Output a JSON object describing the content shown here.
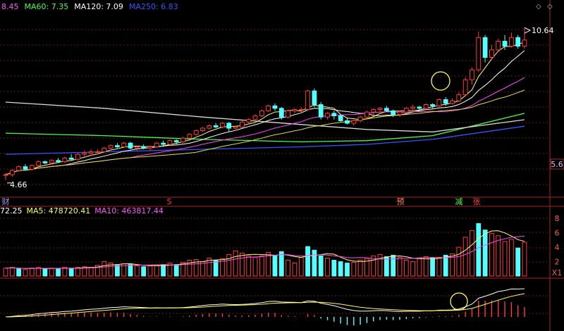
{
  "toolbar": {
    "left_arrow": "◇",
    "right_arrow": "◇"
  },
  "price_header": [
    {
      "text": "8.45",
      "color": "#ff55ff"
    },
    {
      "text": "MA60: 7.35",
      "color": "#44ff44"
    },
    {
      "text": "MA120: 7.09",
      "color": "#ffffff"
    },
    {
      "text": "MA250: 6.83",
      "color": "#3355ff"
    }
  ],
  "volume_header": [
    {
      "text": "72.25",
      "color": "#ffffff"
    },
    {
      "text": "MA5: 478720.41",
      "color": "#ffff44"
    },
    {
      "text": "MA10: 463817.44",
      "color": "#ff55ff"
    }
  ],
  "price_right_label": "5.6",
  "volume_ticks": [
    "8",
    "6",
    "4",
    "2"
  ],
  "volume_unit": "X1",
  "markers": [
    {
      "text": "财",
      "color": "#9999ff"
    },
    {
      "text": "S",
      "color": "#ff3333"
    },
    {
      "text": "预",
      "color": "#ff8844"
    },
    {
      "text": "减",
      "color": "#44ff44"
    },
    {
      "text": "张",
      "color": "#ff4444"
    }
  ],
  "chart_data": {
    "type": "candlestick",
    "price_scale": [
      4.2,
      11.4
    ],
    "high_label": "10.64",
    "low_label": "4.66",
    "candles": [
      [
        4.85,
        4.95,
        4.66,
        4.88
      ],
      [
        4.88,
        5.1,
        4.8,
        5.05
      ],
      [
        5.05,
        5.25,
        5.0,
        5.2
      ],
      [
        5.2,
        5.3,
        5.05,
        5.1
      ],
      [
        5.1,
        5.3,
        5.05,
        5.25
      ],
      [
        5.25,
        5.45,
        5.2,
        5.4
      ],
      [
        5.4,
        5.45,
        5.3,
        5.35
      ],
      [
        5.35,
        5.5,
        5.3,
        5.45
      ],
      [
        5.45,
        5.55,
        5.35,
        5.4
      ],
      [
        5.4,
        5.6,
        5.35,
        5.55
      ],
      [
        5.55,
        5.7,
        5.45,
        5.5
      ],
      [
        5.5,
        5.75,
        5.45,
        5.7
      ],
      [
        5.7,
        5.85,
        5.6,
        5.75
      ],
      [
        5.75,
        5.9,
        5.65,
        5.8
      ],
      [
        5.8,
        5.9,
        5.7,
        5.8
      ],
      [
        5.8,
        6.0,
        5.75,
        5.95
      ],
      [
        5.95,
        6.1,
        5.85,
        6.05
      ],
      [
        6.05,
        6.15,
        5.95,
        6.0
      ],
      [
        6.0,
        6.2,
        5.95,
        6.15
      ],
      [
        6.15,
        6.2,
        5.9,
        5.95
      ],
      [
        5.95,
        6.05,
        5.85,
        6.0
      ],
      [
        6.0,
        6.1,
        5.9,
        5.95
      ],
      [
        5.95,
        6.05,
        5.85,
        6.0
      ],
      [
        6.0,
        6.2,
        5.95,
        6.15
      ],
      [
        6.15,
        6.25,
        6.0,
        6.1
      ],
      [
        6.1,
        6.3,
        6.05,
        6.25
      ],
      [
        6.25,
        6.3,
        6.1,
        6.2
      ],
      [
        6.2,
        6.4,
        6.15,
        6.35
      ],
      [
        6.35,
        6.55,
        6.3,
        6.5
      ],
      [
        6.5,
        6.7,
        6.45,
        6.65
      ],
      [
        6.65,
        6.8,
        6.6,
        6.75
      ],
      [
        6.75,
        6.9,
        6.7,
        6.85
      ],
      [
        6.85,
        6.95,
        6.75,
        6.8
      ],
      [
        6.8,
        7.0,
        6.75,
        6.95
      ],
      [
        6.95,
        7.0,
        6.6,
        6.75
      ],
      [
        6.75,
        6.85,
        6.65,
        6.8
      ],
      [
        6.8,
        7.05,
        6.75,
        7.0
      ],
      [
        7.0,
        7.15,
        6.95,
        7.1
      ],
      [
        7.1,
        7.3,
        7.05,
        7.25
      ],
      [
        7.25,
        7.5,
        7.2,
        7.45
      ],
      [
        7.45,
        7.7,
        7.4,
        7.65
      ],
      [
        7.65,
        7.75,
        7.45,
        7.55
      ],
      [
        7.55,
        7.6,
        7.1,
        7.2
      ],
      [
        7.2,
        7.5,
        7.15,
        7.45
      ],
      [
        7.45,
        7.55,
        7.35,
        7.5
      ],
      [
        7.5,
        7.6,
        7.35,
        7.5
      ],
      [
        7.5,
        8.3,
        7.45,
        8.25
      ],
      [
        8.25,
        8.35,
        7.6,
        7.7
      ],
      [
        7.7,
        7.8,
        7.1,
        7.2
      ],
      [
        7.2,
        7.4,
        7.1,
        7.35
      ],
      [
        7.35,
        7.45,
        7.1,
        7.25
      ],
      [
        7.25,
        7.3,
        7.0,
        7.05
      ],
      [
        7.05,
        7.15,
        6.9,
        6.95
      ],
      [
        6.95,
        7.1,
        6.85,
        7.05
      ],
      [
        7.05,
        7.25,
        7.0,
        7.2
      ],
      [
        7.2,
        7.45,
        7.15,
        7.4
      ],
      [
        7.4,
        7.55,
        7.3,
        7.5
      ],
      [
        7.5,
        7.6,
        7.35,
        7.55
      ],
      [
        7.55,
        7.65,
        7.4,
        7.45
      ],
      [
        7.45,
        7.5,
        7.2,
        7.3
      ],
      [
        7.3,
        7.45,
        7.2,
        7.4
      ],
      [
        7.4,
        7.6,
        7.35,
        7.55
      ],
      [
        7.55,
        7.7,
        7.5,
        7.6
      ],
      [
        7.6,
        7.65,
        7.45,
        7.55
      ],
      [
        7.55,
        7.75,
        7.5,
        7.7
      ],
      [
        7.7,
        7.75,
        7.55,
        7.65
      ],
      [
        7.65,
        7.95,
        7.6,
        7.9
      ],
      [
        7.9,
        8.0,
        7.65,
        7.75
      ],
      [
        7.75,
        7.95,
        7.7,
        7.85
      ],
      [
        7.85,
        8.2,
        7.8,
        8.1
      ],
      [
        8.1,
        8.8,
        8.05,
        8.7
      ],
      [
        8.7,
        9.2,
        8.5,
        9.1
      ],
      [
        9.1,
        10.64,
        9.0,
        10.4
      ],
      [
        10.4,
        10.5,
        9.4,
        9.6
      ],
      [
        9.6,
        10.1,
        9.5,
        9.9
      ],
      [
        9.9,
        10.35,
        9.85,
        10.25
      ],
      [
        10.25,
        10.5,
        9.9,
        10.05
      ],
      [
        10.05,
        10.6,
        10.0,
        10.4
      ],
      [
        10.4,
        10.5,
        9.95,
        10.05
      ],
      [
        10.05,
        10.8,
        9.95,
        10.3
      ]
    ],
    "ma": [
      {
        "name": "MA60",
        "color": "#44ff44",
        "points": [
          [
            0,
            6.55
          ],
          [
            15,
            6.45
          ],
          [
            30,
            6.3
          ],
          [
            45,
            6.2
          ],
          [
            55,
            6.25
          ],
          [
            65,
            6.45
          ],
          [
            79,
            7.35
          ]
        ]
      },
      {
        "name": "MA120",
        "color": "#d8d8d8",
        "points": [
          [
            0,
            7.8
          ],
          [
            15,
            7.55
          ],
          [
            30,
            7.2
          ],
          [
            45,
            6.9
          ],
          [
            55,
            6.7
          ],
          [
            65,
            6.6
          ],
          [
            79,
            7.09
          ]
        ]
      },
      {
        "name": "MA250",
        "color": "#3355ff",
        "points": [
          [
            0,
            5.7
          ],
          [
            15,
            5.8
          ],
          [
            30,
            5.9
          ],
          [
            45,
            6.0
          ],
          [
            55,
            6.1
          ],
          [
            65,
            6.3
          ],
          [
            79,
            6.83
          ]
        ]
      }
    ],
    "volume_scale": [
      0,
      9
    ],
    "volume": [
      [
        1.1,
        1
      ],
      [
        1.2,
        1
      ],
      [
        1.0,
        0
      ],
      [
        0.9,
        1
      ],
      [
        1.1,
        1
      ],
      [
        1.2,
        1
      ],
      [
        1.0,
        0
      ],
      [
        1.1,
        1
      ],
      [
        1.0,
        0
      ],
      [
        1.2,
        1
      ],
      [
        1.1,
        0
      ],
      [
        1.2,
        1
      ],
      [
        1.3,
        1
      ],
      [
        1.2,
        1
      ],
      [
        1.5,
        2
      ],
      [
        2.0,
        1
      ],
      [
        1.8,
        1
      ],
      [
        1.5,
        0
      ],
      [
        1.7,
        1
      ],
      [
        1.6,
        0
      ],
      [
        1.4,
        1
      ],
      [
        1.3,
        0
      ],
      [
        1.4,
        1
      ],
      [
        1.5,
        1
      ],
      [
        1.6,
        0
      ],
      [
        1.8,
        1
      ],
      [
        1.6,
        0
      ],
      [
        1.9,
        1
      ],
      [
        2.2,
        1
      ],
      [
        2.3,
        1
      ],
      [
        2.0,
        1
      ],
      [
        2.5,
        1
      ],
      [
        2.2,
        0
      ],
      [
        2.4,
        1
      ],
      [
        3.0,
        1
      ],
      [
        3.5,
        1
      ],
      [
        3.2,
        1
      ],
      [
        2.8,
        1
      ],
      [
        2.6,
        1
      ],
      [
        2.8,
        1
      ],
      [
        3.3,
        1
      ],
      [
        2.9,
        0
      ],
      [
        3.4,
        0
      ],
      [
        2.2,
        1
      ],
      [
        1.8,
        1
      ],
      [
        2.6,
        1
      ],
      [
        4.1,
        0
      ],
      [
        3.6,
        0
      ],
      [
        2.8,
        0
      ],
      [
        2.5,
        1
      ],
      [
        2.2,
        0
      ],
      [
        2.0,
        0
      ],
      [
        1.8,
        0
      ],
      [
        1.9,
        1
      ],
      [
        2.2,
        1
      ],
      [
        2.4,
        1
      ],
      [
        2.8,
        1
      ],
      [
        3.0,
        1
      ],
      [
        2.7,
        0
      ],
      [
        2.9,
        0
      ],
      [
        2.6,
        1
      ],
      [
        2.2,
        1
      ],
      [
        2.0,
        1
      ],
      [
        2.5,
        1
      ],
      [
        2.7,
        1
      ],
      [
        2.5,
        0
      ],
      [
        2.6,
        1
      ],
      [
        2.9,
        0
      ],
      [
        3.1,
        1
      ],
      [
        4.0,
        1
      ],
      [
        5.4,
        1
      ],
      [
        6.3,
        1
      ],
      [
        7.3,
        0
      ],
      [
        6.4,
        0
      ],
      [
        5.9,
        1
      ],
      [
        5.6,
        1
      ],
      [
        4.8,
        1
      ],
      [
        5.1,
        1
      ],
      [
        3.9,
        0
      ],
      [
        4.7,
        1
      ]
    ]
  }
}
